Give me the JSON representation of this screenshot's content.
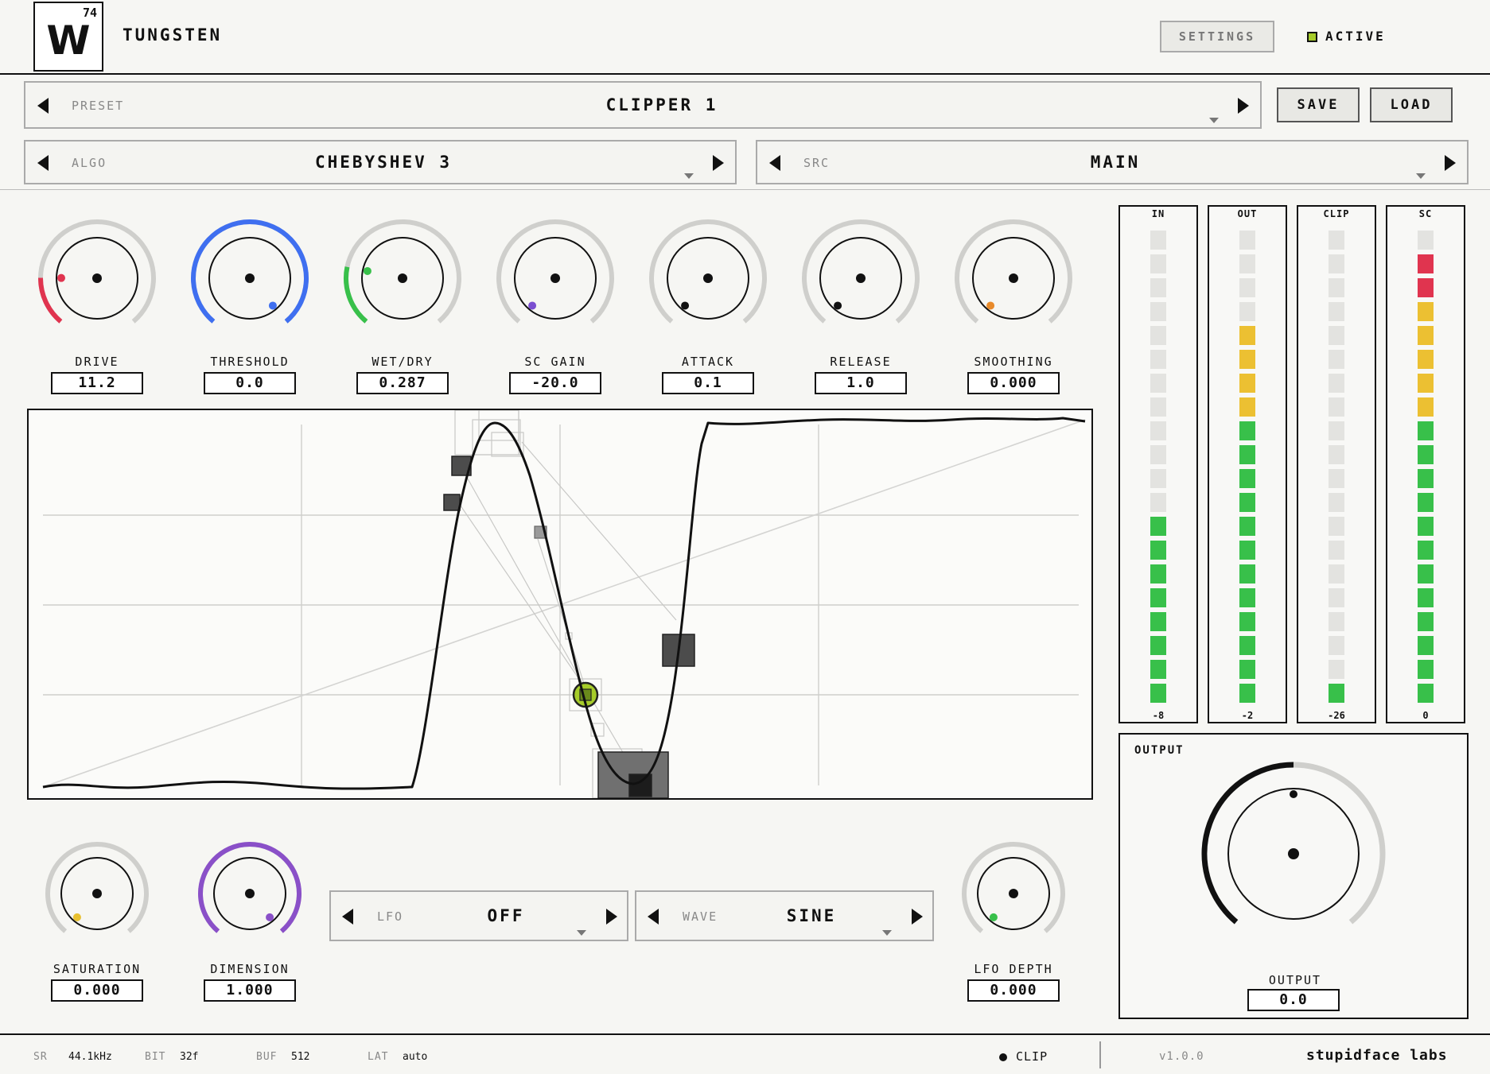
{
  "header": {
    "logo": {
      "number": "74",
      "symbol": "W"
    },
    "title": "TUNGSTEN",
    "settings_label": "SETTINGS",
    "active_label": "ACTIVE",
    "active_color": "#a6cc2a"
  },
  "preset": {
    "label": "PRESET",
    "value": "CLIPPER 1",
    "save_label": "SAVE",
    "load_label": "LOAD"
  },
  "algo": {
    "label": "ALGO",
    "value": "CHEBYSHEV 3"
  },
  "src": {
    "label": "SRC",
    "value": "MAIN"
  },
  "knobs": [
    {
      "label": "DRIVE",
      "value": "11.2",
      "level": 0.18,
      "color": "#e0344f"
    },
    {
      "label": "THRESHOLD",
      "value": "0.0",
      "level": 1.0,
      "color": "#3f6ff0"
    },
    {
      "label": "WET/DRY",
      "value": "0.287",
      "level": 0.22,
      "color": "#38c04a"
    },
    {
      "label": "SC GAIN",
      "value": "-20.0",
      "level": 0.0,
      "color": "#7a4ed0"
    },
    {
      "label": "ATTACK",
      "value": "0.1",
      "level": 0.0,
      "color": "#111111"
    },
    {
      "label": "RELEASE",
      "value": "1.0",
      "level": 0.0,
      "color": "#111111"
    },
    {
      "label": "SMOOTHING",
      "value": "0.000",
      "level": 0.0,
      "color": "#e88a2a"
    }
  ],
  "bottom_knobs": [
    {
      "label": "SATURATION",
      "value": "0.000",
      "level": 0.0,
      "color": "#e8c030"
    },
    {
      "label": "DIMENSION",
      "value": "1.000",
      "level": 1.0,
      "color": "#8a50c8"
    },
    {
      "label": "LFO DEPTH",
      "value": "0.000",
      "level": 0.0,
      "color": "#38c04a"
    }
  ],
  "lfo": {
    "label": "LFO",
    "value": "OFF"
  },
  "wave": {
    "label": "WAVE",
    "value": "SINE"
  },
  "meters": [
    {
      "label": "IN",
      "value": "-8",
      "lit": 8,
      "colors": {
        "green": "#38c04a",
        "yellow": "#ecc032",
        "red": "#e0344f",
        "off": "#e3e3e0"
      }
    },
    {
      "label": "OUT",
      "value": "-2",
      "lit": 16
    },
    {
      "label": "CLIP",
      "value": "-26",
      "lit": 1
    },
    {
      "label": "SC",
      "value": "0",
      "lit": 19
    }
  ],
  "output": {
    "title": "OUTPUT",
    "label": "OUTPUT",
    "value": "0.0",
    "level": 0.5
  },
  "footer": {
    "sr_key": "SR",
    "sr": "44.1kHz",
    "bit_key": "BIT",
    "bit": "32f",
    "buf_key": "BUF",
    "buf": "512",
    "lat_key": "LAT",
    "lat": "auto",
    "clip_label": "CLIP",
    "version": "v1.0.0",
    "company": "stupidface labs"
  }
}
